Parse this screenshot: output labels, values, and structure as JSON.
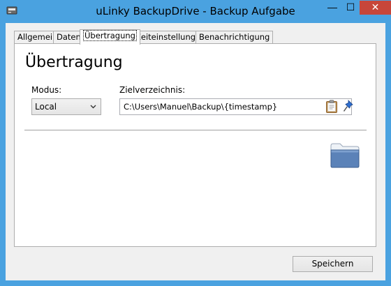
{
  "window": {
    "title": "uLinky BackupDrive - Backup Aufgabe",
    "buttons": {
      "minimize": "—",
      "maximize": "☐",
      "close": "✕"
    }
  },
  "tabs": [
    {
      "label": "Allgemein",
      "active": false
    },
    {
      "label": "Daten",
      "active": false
    },
    {
      "label": "Übertragung",
      "active": true
    },
    {
      "label": "Zeiteinstellungen",
      "active": false
    },
    {
      "label": "Benachrichtigung",
      "active": false
    }
  ],
  "panel": {
    "heading": "Übertragung",
    "modus_label": "Modus:",
    "modus_value": "Local",
    "target_label": "Zielverzeichnis:",
    "target_value": "C:\\Users\\Manuel\\Backup\\{timestamp}",
    "icons": [
      "clipboard-icon",
      "pin-icon",
      "folder-icon"
    ]
  },
  "footer": {
    "save_label": "Speichern"
  },
  "colors": {
    "titlebar": "#4aa2e0",
    "close": "#c7463a",
    "folder": "#5b82b8"
  }
}
